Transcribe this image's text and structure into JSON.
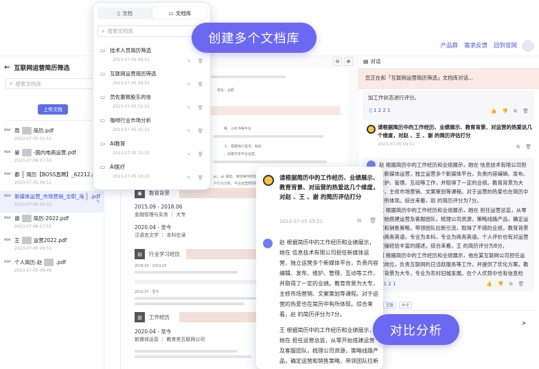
{
  "topbar": {
    "links": [
      "产品群",
      "需求反馈",
      "回到官网"
    ]
  },
  "sidebar": {
    "title": "互联网运营简历筛选",
    "search_placeholder": "搜索文档库",
    "upload_label": "上传文档",
    "files": [
      {
        "name_pre": "周",
        "name_post": "简历.pdf",
        "date": "2023-07-05 02:53",
        "active": false
      },
      {
        "name_pre": "晏",
        "name_post": "-国内电商运营.pdf",
        "date": "2023-07-08 07:53",
        "active": false
      },
      {
        "name_pre": "都",
        "name_post": "简历【BOSS直聘】_62212.pdf",
        "date": "2023-07-05 09:51",
        "active": false
      },
      {
        "name_pre": "新媒体运营_市场营销_全职_海",
        "name_post": ".pdf",
        "date": "2023-07-05 09:51",
        "active": true
      },
      {
        "name_pre": "谢",
        "name_post": "简历-2022.pdf",
        "date": "2023-07-08 07:53",
        "active": false
      },
      {
        "name_pre": "王",
        "name_post": "运营2022.pdf",
        "date": "2023-07-05 09:51",
        "active": false
      },
      {
        "name_pre": "个人简历-赵",
        "name_post": ".pdf",
        "date": "2023-07-05 09:49",
        "active": false
      }
    ]
  },
  "dropdown": {
    "tab_doc": "文档",
    "tab_lib": "文档库",
    "search_placeholder": "搜索文档库",
    "items": [
      {
        "name": "技术人员简历筛选",
        "date": "2023-07-05 09:51"
      },
      {
        "name": "互联网运营简历筛选",
        "date": "2023-07-05 09:51"
      },
      {
        "name": "员佐惠致股东的信",
        "date": "2023-07-05 02:53"
      },
      {
        "name": "咖啡行业市场分析",
        "date": "2023-07-05 02:53"
      },
      {
        "name": "AI教育",
        "date": "2023-07-05 10:25"
      },
      {
        "name": "AI医疗",
        "date": "2023-07-05 10:25"
      }
    ]
  },
  "document": {
    "contact_line": "电话：",
    "contact_line2": "地址：合肥",
    "tools_line": "等、小红书等平台",
    "line_a": "工，根据用户需求，制定",
    "line_b": "，创建共享平台运营、",
    "line_c": "pc、pr 赛剪、荣悦等传统软件视频运营，美的媒体服务于工作中",
    "line_d": "户行为分析，平台运营规则等",
    "education_title": "教育背景",
    "edu1_years": "2015.09 - 2018.06",
    "edu1_school": "金融管理与实务 ｜ 大专",
    "edu2_years": "2020.04 - 至今",
    "edu2_school": "汉语言文学 ｜ 本科在读",
    "industry_title": "行业学习经历",
    "ind_line1": "2018.03 - 2019.03",
    "ind_line2": "2019.07 - 至今",
    "work_title": "工作经历",
    "work_years": "2020.04 - 至今",
    "work_company": "新媒体运营 ｜ 教育类互联网公司"
  },
  "chat": {
    "tab_label": "对话",
    "intro": "您正在和「互联网运营简历筛选」文档库对话...",
    "first_tail": "加工作状态进行评分。",
    "page_refs1": "1 2 2 1",
    "question": "请根据简历中的工作经历、业绩展示、教育背景、对运营的热爱这几个维度，对赵 、王 、谢 的简历评估打分",
    "question_date": "2023-07-05 09:51",
    "answer_p1": "赵 根据简历中的工作经历和业绩展示，她在 信息技术有限公司担任新媒体运营，独立运营多个新媒体平台，负责内容编辑、发布、维护、管理、互动等工作，并取得了一定的业绩。教育背景为大专，主修市场营销、文案策划等课程。对于运营的热爱也在简历中有所体现。综合来看，赵 的简历评分为7分。",
    "answer_p2": "王 根据简历中的工作经历和业绩展示，她在 担任运营总监，从零开始搭建运营及客服团队，梳理公司资源，策略线路产品，确定运营和销售策略，带领团队拉新引流，取得了不错的业绩，教育背景为商务英语，专业为本科，专业为商务英语。个人评价也有对运营实操经验丰富的描述。综合来看，王 的简历评分为8分。",
    "answer_p3": "谢 根据简历中的工作经历和业绩展示，他在某互联网公司担任运营岗位，负责互联网的日活跃服务等工作，并提供了优化方案。教育背景为大专，专业为农村旧城发展。在个人优势中也有信息检索、获取及分析等能力描述。综合来看，谢 的简历评分为6分。",
    "page_refs2": "1 1 2 1",
    "tags": [
      "互联",
      "中文"
    ]
  },
  "popup": {
    "question": "请根据简历中的工作经历、业绩展示、教育背景、对运营的热爱这几个维度，对赵 、王 、谢 的简历评估打分",
    "date": "2023-07-05 09:51",
    "answer_p1": "赵 根据简历中的工作经历和业绩展示，她在 信息技术有限公司担任新媒体运营，独立运营多个新媒体平台，负责内容编辑、发布、维护、管理、互动等工作，并取得了一定的业绩。教育背景为大专，主修市场营销、文案策划等课程。对于运营的热爱也在简历中有所体现。综合来看，赵 的简历评分为7分。",
    "answer_p2": "王 根据简历中的工作经历和业绩展示，她在 担任运营总监，从零开始搭建运营及客服团队，梳理公司资源，策略线路产品，确定运营和销售策略，带领团队拉新"
  },
  "callouts": {
    "create_lib": "创建多个文档库",
    "compare": "对比分析"
  }
}
